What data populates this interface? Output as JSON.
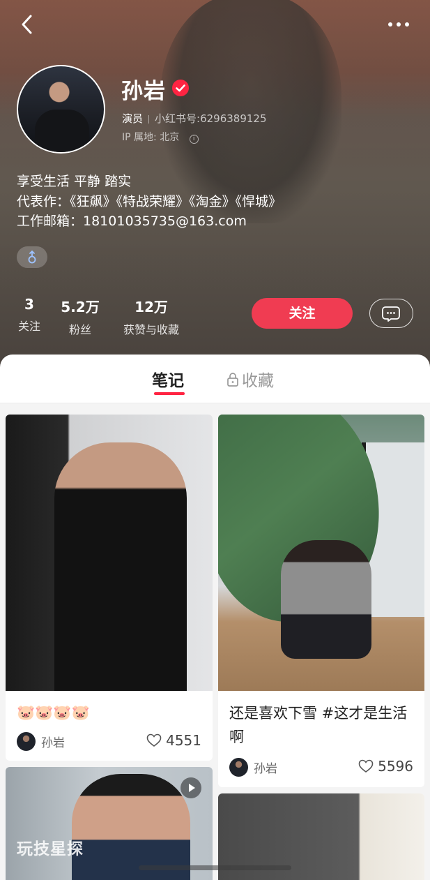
{
  "profile": {
    "name": "孙岩",
    "role": "演员",
    "red_id_label": "小红书号:",
    "red_id": "6296389125",
    "ip_label": "IP 属地:",
    "ip_location": "北京",
    "bio_lines": [
      "享受生活 平静 踏实",
      "代表作：《狂飙》《特战荣耀》《淘金》《悍城》",
      "工作邮箱：18101035735@163.com"
    ],
    "gender_symbol": "♂"
  },
  "stats": [
    {
      "value": "3",
      "label": "关注"
    },
    {
      "value": "5.2万",
      "label": "粉丝"
    },
    {
      "value": "12万",
      "label": "获赞与收藏"
    }
  ],
  "actions": {
    "follow_label": "关注"
  },
  "tabs": [
    {
      "label": "笔记",
      "active": true
    },
    {
      "label": "收藏",
      "active": false,
      "locked": true
    }
  ],
  "notes": [
    {
      "title": "🐷🐷🐷🐷",
      "author": "孙岩",
      "likes": "4551"
    },
    {
      "title": "还是喜欢下雪 #这才是生活啊",
      "author": "孙岩",
      "likes": "5596"
    },
    {
      "watermark": "玩技星探",
      "is_video": true
    },
    {}
  ],
  "colors": {
    "accent": "#f03c52",
    "verified": "#ff2442",
    "feed_bg": "#f4f4f4"
  },
  "icons": [
    "back-icon",
    "more-icon",
    "verified-icon",
    "info-icon",
    "male-icon",
    "message-icon",
    "lock-icon",
    "heart-icon",
    "play-icon"
  ]
}
